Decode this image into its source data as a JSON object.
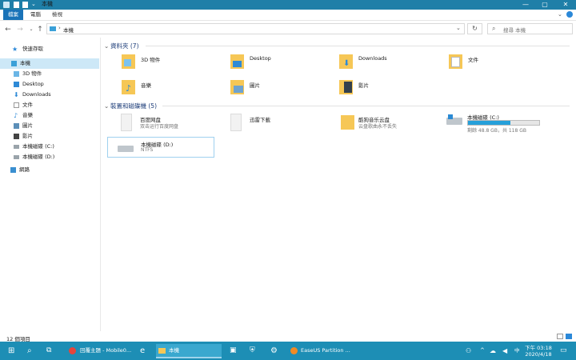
{
  "title_bar": {
    "title": "本機",
    "minimize": "—",
    "maximize": "▢",
    "close": "✕"
  },
  "ribbon": {
    "tabs": [
      "檔案",
      "電腦",
      "檢視"
    ]
  },
  "address": {
    "path": "本機",
    "search_placeholder": "搜尋 本機"
  },
  "sidebar": {
    "items": [
      {
        "label": "快速存取",
        "icon": "star-icon"
      },
      {
        "label": "本機",
        "icon": "computer-icon"
      },
      {
        "label": "3D 物件",
        "icon": "cube-icon"
      },
      {
        "label": "Desktop",
        "icon": "desktop-icon"
      },
      {
        "label": "Downloads",
        "icon": "download-icon"
      },
      {
        "label": "文件",
        "icon": "document-icon"
      },
      {
        "label": "音樂",
        "icon": "music-icon"
      },
      {
        "label": "圖片",
        "icon": "picture-icon"
      },
      {
        "label": "影片",
        "icon": "video-icon"
      },
      {
        "label": "本機磁碟 (C:)",
        "icon": "drive-icon"
      },
      {
        "label": "本機磁碟 (D:)",
        "icon": "drive-icon"
      },
      {
        "label": "網路",
        "icon": "network-icon"
      }
    ]
  },
  "folders_section": {
    "title": "資料夾 (7)",
    "items": [
      "3D 物件",
      "Desktop",
      "Downloads",
      "文件",
      "音樂",
      "圖片",
      "影片"
    ]
  },
  "devices_section": {
    "title": "裝置和磁碟機 (5)",
    "items": [
      {
        "name": "百度网盘",
        "sub": "双击运行百度网盘"
      },
      {
        "name": "迅雷下載",
        "sub": ""
      },
      {
        "name": "酷狗音乐云盘",
        "sub": "云盘歌曲永不丢失"
      },
      {
        "name": "本機磁碟 (C:)",
        "sub": "剩餘 48.8 GB，共 118 GB",
        "used_fraction": 0.59
      },
      {
        "name": "本機磁碟 (D:)",
        "sub": "NTFS"
      }
    ]
  },
  "status": {
    "count": "12 個項目"
  },
  "taskbar": {
    "apps": [
      "回覆主題 - Mobile0...",
      "本機",
      "EaseUS Partition ..."
    ],
    "time": "下午 03:18",
    "date": "2020/4/18",
    "ime": "中"
  },
  "colors": {
    "accent": "#1a73b8",
    "taskbar": "#1d8eb5",
    "folder": "#f6c756",
    "drive_bar": "#26a0da"
  }
}
